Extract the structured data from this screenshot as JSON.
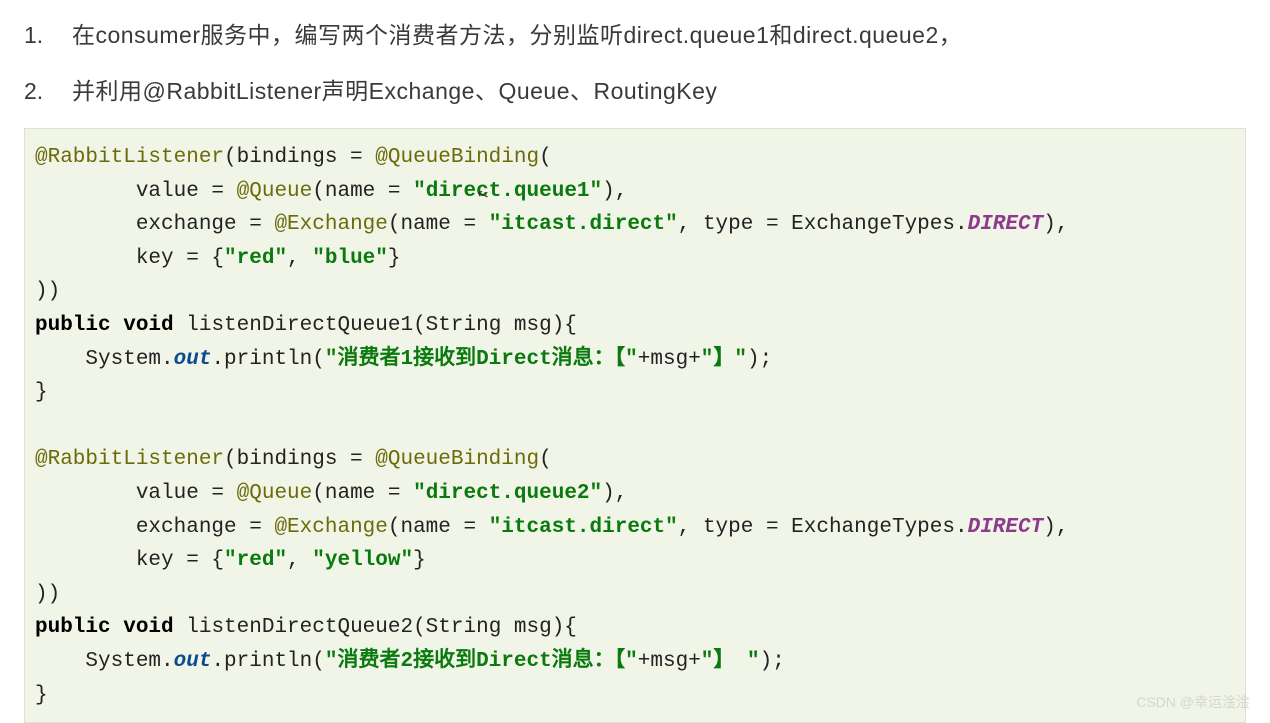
{
  "list": {
    "item1_num": "1.",
    "item1_text": "在consumer服务中，编写两个消费者方法，分别监听direct.queue1和direct.queue2，",
    "item2_num": "2.",
    "item2_text": "并利用@RabbitListener声明Exchange、Queue、RoutingKey"
  },
  "code": {
    "rl1": "@RabbitListener",
    "bindings1": "(bindings = ",
    "qb1": "@QueueBinding",
    "open1": "(",
    "value1a": "        value = ",
    "queue1": "@Queue",
    "name1a": "(name = ",
    "str_q1": "\"direct.queue1\"",
    "close_nm1": "),",
    "exch_lbl1": "        exchange = ",
    "exch1": "@Exchange",
    "name1b": "(name = ",
    "str_e1": "\"itcast.direct\"",
    "type1": ", type = ExchangeTypes.",
    "direct1": "DIRECT",
    "close_ex1": "),",
    "key1": "        key = {",
    "str_red1": "\"red\"",
    "comma1": ", ",
    "str_blue1": "\"blue\"",
    "close_key1": "}",
    "close_ann1": "))",
    "pub1": "public",
    "void1": " void",
    "method1": " listenDirectQueue1(String msg){",
    "sysout1a": "    System.",
    "out1": "out",
    "println1a": ".println(",
    "str_msg1a": "\"消费者1接收到Direct消息：【\"",
    "plusmsg1": "+msg+",
    "str_msg1b": "\"】\"",
    "println1b": ");",
    "close_m1": "}",
    "rl2": "@RabbitListener",
    "bindings2": "(bindings = ",
    "qb2": "@QueueBinding",
    "open2": "(",
    "value2a": "        value = ",
    "queue2": "@Queue",
    "name2a": "(name = ",
    "str_q2": "\"direct.queue2\"",
    "close_nm2": "),",
    "exch_lbl2": "        exchange = ",
    "exch2": "@Exchange",
    "name2b": "(name = ",
    "str_e2": "\"itcast.direct\"",
    "type2": ", type = ExchangeTypes.",
    "direct2": "DIRECT",
    "close_ex2": "),",
    "key2": "        key = {",
    "str_red2": "\"red\"",
    "comma2": ", ",
    "str_yel2": "\"yellow\"",
    "close_key2": "}",
    "close_ann2": "))",
    "pub2": "public",
    "void2": " void",
    "method2": " listenDirectQueue2(String msg){",
    "sysout2a": "    System.",
    "out2": "out",
    "println2a": ".println(",
    "str_msg2a": "\"消费者2接收到Direct消息：【\"",
    "plusmsg2": "+msg+",
    "str_msg2b": "\"】 \"",
    "println2b": ");",
    "close_m2": "}"
  },
  "watermark": "CSDN @幸运淦淦"
}
